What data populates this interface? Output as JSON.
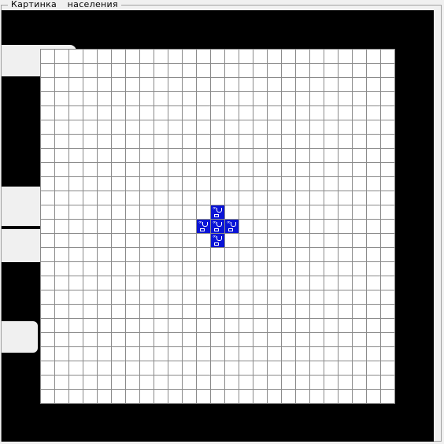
{
  "groupbox": {
    "title": "Картинка  населения"
  },
  "population": {
    "grid_cols": 25,
    "grid_rows": 25,
    "cell_color": "#0a14d6",
    "occupied_cells": [
      {
        "col": 12,
        "row": 11
      },
      {
        "col": 11,
        "row": 12
      },
      {
        "col": 12,
        "row": 12
      },
      {
        "col": 13,
        "row": 12
      },
      {
        "col": 12,
        "row": 13
      }
    ]
  }
}
